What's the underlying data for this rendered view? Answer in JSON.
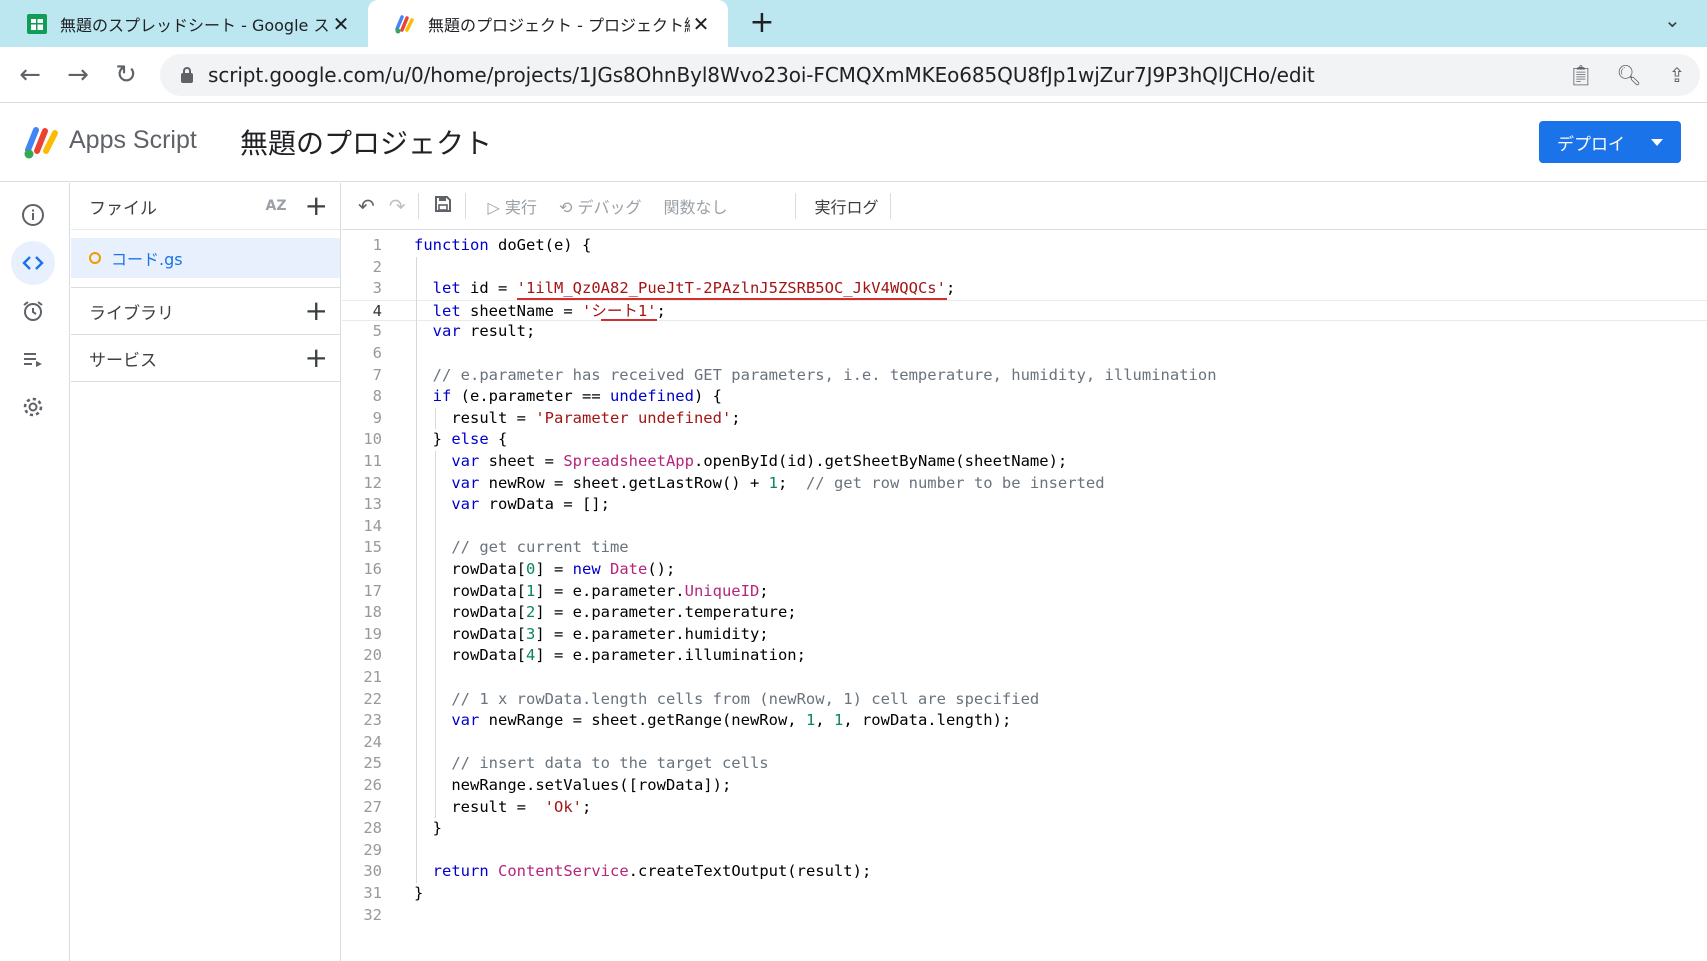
{
  "browser": {
    "tabs": [
      {
        "title": "無題のスプレッドシート - Google スプ",
        "active": false,
        "icon": "sheets-icon"
      },
      {
        "title": "無題のプロジェクト - プロジェクト編集",
        "active": true,
        "icon": "apps-script-icon"
      }
    ],
    "new_tab": "+",
    "url": "script.google.com/u/0/home/projects/1JGs8OhnByl8Wvo23oi-FCMQXmMKEo685QU8fJp1wjZur7J9P3hQlJCHo/edit"
  },
  "app": {
    "brand": "Apps Script",
    "project_title": "無題のプロジェクト",
    "deploy_label": "デプロイ"
  },
  "files_panel": {
    "header": "ファイル",
    "sort_label": "AZ",
    "file": "コード.gs",
    "libraries": "ライブラリ",
    "services": "サービス"
  },
  "toolbar": {
    "run": "実行",
    "debug": "デバッグ",
    "function_select": "関数なし",
    "exec_log": "実行ログ"
  },
  "code": {
    "current_line": 4,
    "lines": [
      "function doGet(e) {",
      "",
      "  let id = '1ilM_Qz0A82_PueJtT-2PAzlnJ5ZSRB5OC_JkV4WQQCs';",
      "  let sheetName = 'シート1';",
      "  var result;",
      "",
      "  // e.parameter has received GET parameters, i.e. temperature, humidity, illumination",
      "  if (e.parameter == undefined) {",
      "    result = 'Parameter undefined';",
      "  } else {",
      "    var sheet = SpreadsheetApp.openById(id).getSheetByName(sheetName);",
      "    var newRow = sheet.getLastRow() + 1;  // get row number to be inserted",
      "    var rowData = [];",
      "",
      "    // get current time",
      "    rowData[0] = new Date();",
      "    rowData[1] = e.parameter.UniqueID;",
      "    rowData[2] = e.parameter.temperature;",
      "    rowData[3] = e.parameter.humidity;",
      "    rowData[4] = e.parameter.illumination;",
      "",
      "    // 1 x rowData.length cells from (newRow, 1) cell are specified",
      "    var newRange = sheet.getRange(newRow, 1, 1, rowData.length);",
      "",
      "    // insert data to the target cells",
      "    newRange.setValues([rowData]);",
      "    result =  'Ok';",
      "  }",
      "",
      "  return ContentService.createTextOutput(result);",
      "}",
      ""
    ]
  },
  "colors": {
    "accent": "#1a73e8",
    "tabbar": "#bce6f0",
    "annotation": "#d32f2f"
  }
}
